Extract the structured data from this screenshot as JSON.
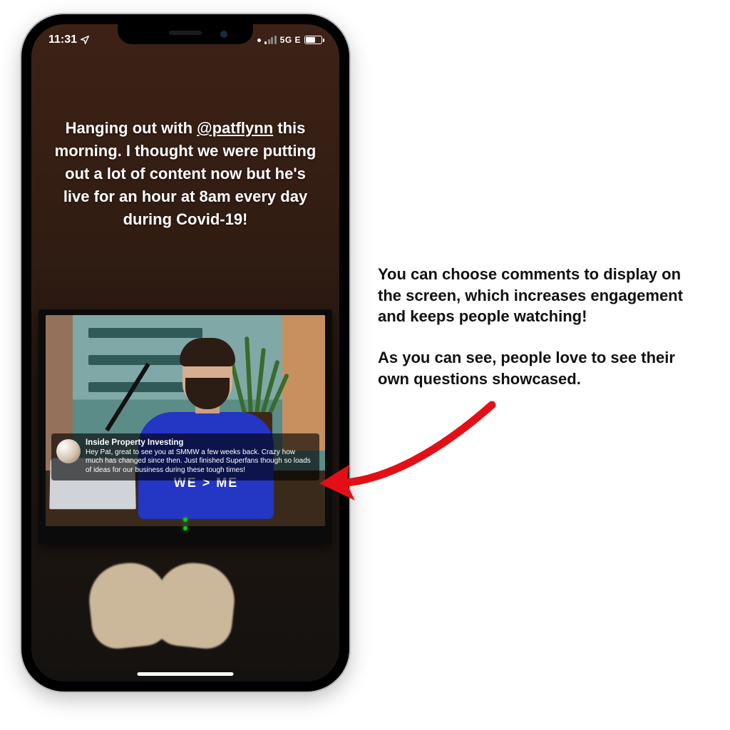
{
  "status_bar": {
    "time": "11:31",
    "network": "5G E"
  },
  "story": {
    "caption_pre": "Hanging out with ",
    "mention": "@patflynn",
    "caption_post": " this morning. I thought we were putting out a lot of content now but he's live for an hour at 8am every day during Covid-19!",
    "shirt_text": "WE > ME"
  },
  "comment": {
    "author": "Inside Property Investing",
    "body": "Hey Pat, great to see you at SMMW a few weeks back. Crazy how much has changed since then. Just finished Superfans though so loads of ideas for our business during these tough times!"
  },
  "annotation": {
    "p1": "You can choose comments to display on the screen, which increases engagement and keeps people watching!",
    "p2": "As you can see, people love to see their own questions showcased."
  },
  "colors": {
    "arrow": "#e40f16"
  }
}
